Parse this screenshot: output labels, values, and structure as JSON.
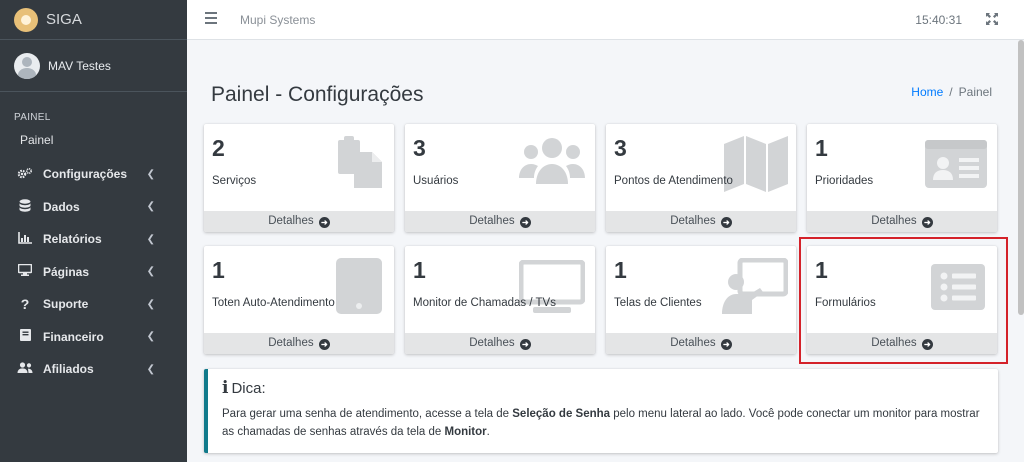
{
  "brand": {
    "name": "SIGA"
  },
  "user": {
    "name": "MAV Testes"
  },
  "sidebar": {
    "header": "PAINEL",
    "painel_link": "Painel",
    "items": [
      {
        "label": "Configurações",
        "icon": "cogs-icon"
      },
      {
        "label": "Dados",
        "icon": "database-icon"
      },
      {
        "label": "Relatórios",
        "icon": "chart-icon"
      },
      {
        "label": "Páginas",
        "icon": "desktop-icon"
      },
      {
        "label": "Suporte",
        "icon": "question-icon"
      },
      {
        "label": "Financeiro",
        "icon": "book-icon"
      },
      {
        "label": "Afiliados",
        "icon": "users-icon"
      }
    ]
  },
  "navbar": {
    "brand": "Mupi Systems",
    "time": "15:40:31"
  },
  "page": {
    "title": "Painel - Configurações",
    "breadcrumb": {
      "home": "Home",
      "separator": "/",
      "current": "Painel"
    }
  },
  "cards": [
    {
      "count": "2",
      "label": "Serviços",
      "icon": "copy-icon",
      "footer": "Detalhes"
    },
    {
      "count": "3",
      "label": "Usuários",
      "icon": "users-icon",
      "footer": "Detalhes"
    },
    {
      "count": "3",
      "label": "Pontos de Atendimento",
      "icon": "map-icon",
      "footer": "Detalhes"
    },
    {
      "count": "1",
      "label": "Prioridades",
      "icon": "id-card-icon",
      "footer": "Detalhes"
    },
    {
      "count": "1",
      "label": "Toten Auto-Atendimento",
      "icon": "tablet-icon",
      "footer": "Detalhes"
    },
    {
      "count": "1",
      "label": "Monitor de Chamadas / TVs",
      "icon": "monitor-icon",
      "footer": "Detalhes"
    },
    {
      "count": "1",
      "label": "Telas de Clientes",
      "icon": "chalkboard-teacher-icon",
      "footer": "Detalhes"
    },
    {
      "count": "1",
      "label": "Formulários",
      "icon": "list-alt-icon",
      "footer": "Detalhes"
    }
  ],
  "dica": {
    "title": "Dica:",
    "text_1": "Para gerar uma senha de atendimento, acesse a tela de ",
    "bold_1": "Seleção de Senha",
    "text_2": " pelo menu lateral ao lado. Você pode conectar um monitor para mostrar as chamadas de senhas através da tela de ",
    "bold_2": "Monitor",
    "text_3": "."
  },
  "colors": {
    "sidebar_bg": "#343a40",
    "link": "#007bff",
    "callout_accent": "#117a8b",
    "highlight": "#d4222a"
  }
}
